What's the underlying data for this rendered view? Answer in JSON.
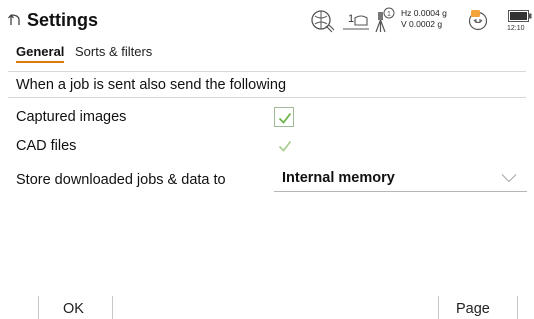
{
  "title": "Settings",
  "status": {
    "prism_label": "1",
    "tilt_hz": "Hz 0.0004 g",
    "tilt_v": "V  0.0002 g",
    "clock": "12:10"
  },
  "tabs": [
    {
      "label": "General",
      "active": true
    },
    {
      "label": "Sorts & filters",
      "active": false
    }
  ],
  "section_heading": "When a job is sent also send the following",
  "rows": {
    "captured_images": {
      "label": "Captured images",
      "checked": true
    },
    "cad_files": {
      "label": "CAD files",
      "checked": true,
      "enabled": false
    },
    "store": {
      "label": "Store downloaded jobs & data to",
      "value": "Internal memory"
    }
  },
  "softkeys": {
    "ok": "OK",
    "page": "Page"
  },
  "colors": {
    "accent": "#e07a10",
    "check": "#6fb64a",
    "check_disabled": "#a9cf95"
  }
}
